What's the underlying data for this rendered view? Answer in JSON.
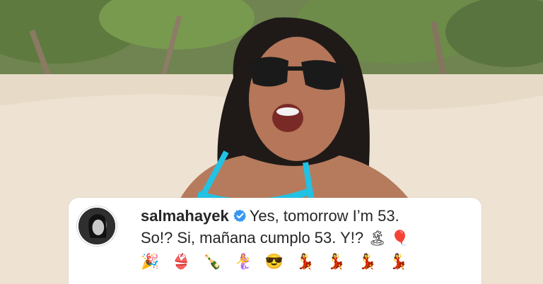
{
  "photo": {
    "subject": "photo-background"
  },
  "caption": {
    "username": "salmahayek",
    "line1": "Yes, tomorrow I’m 53.",
    "line2": "So!? Si, mañana cumplo 53. Y!?",
    "line2_emoji": "🏝 🎈",
    "emoji_row": "🎉 👙 🍾 🧜‍♀️ 😎 💃 💃 💃 💃"
  },
  "colors": {
    "text": "#262626",
    "verified": "#3897f0",
    "card": "#ffffff",
    "bikini": "#22c2e5"
  },
  "icons": {
    "verified": "verified-badge-icon",
    "avatar": "avatar"
  }
}
